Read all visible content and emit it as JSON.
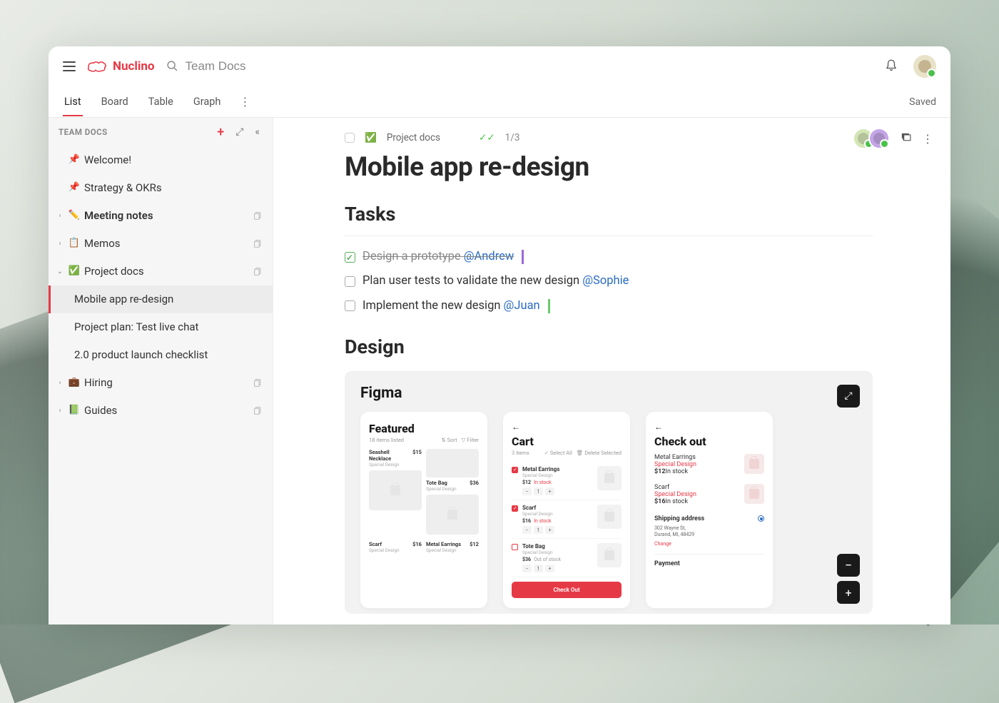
{
  "brand": "Nuclino",
  "search": {
    "placeholder": "Team Docs"
  },
  "saved_label": "Saved",
  "view_tabs": [
    "List",
    "Board",
    "Table",
    "Graph"
  ],
  "active_tab": 0,
  "sidebar": {
    "title": "TEAM DOCS",
    "items": [
      {
        "icon": "📌",
        "name": "Welcome!",
        "pinned": true
      },
      {
        "icon": "📌",
        "name": "Strategy & OKRs",
        "pinned": true
      },
      {
        "icon": "✏️",
        "name": "Meeting notes",
        "has_children": true,
        "bold": true,
        "copyable": true
      },
      {
        "icon": "📋",
        "name": "Memos",
        "has_children": true,
        "copyable": true
      },
      {
        "icon": "✅",
        "name": "Project docs",
        "has_children": true,
        "expanded": true,
        "copyable": true,
        "children": [
          {
            "name": "Mobile app re-design",
            "active": true
          },
          {
            "name": "Project plan: Test live chat"
          },
          {
            "name": "2.0 product launch checklist"
          }
        ]
      },
      {
        "icon": "💼",
        "name": "Hiring",
        "has_children": true,
        "copyable": true
      },
      {
        "icon": "📗",
        "name": "Guides",
        "has_children": true,
        "copyable": true
      }
    ]
  },
  "page": {
    "breadcrumb": {
      "icon": "✅",
      "label": "Project docs"
    },
    "progress": "1/3",
    "title": "Mobile app re-design",
    "sections": {
      "tasks_heading": "Tasks",
      "design_heading": "Design"
    },
    "tasks": [
      {
        "done": true,
        "text": "Design a prototype ",
        "mention": "@Andrew",
        "cursor": "purple"
      },
      {
        "done": false,
        "text": "Plan user tests to validate the new design ",
        "mention": "@Sophie"
      },
      {
        "done": false,
        "text": "Implement the new design ",
        "mention": "@Juan",
        "cursor": "green"
      }
    ]
  },
  "figma": {
    "title": "Figma",
    "screens": {
      "featured": {
        "heading": "Featured",
        "count_label": "18 items listed",
        "sort_label": "Sort",
        "filter_label": "Filter",
        "products": [
          {
            "name": "Seashell Necklace",
            "sub": "Special Design",
            "price": "$15"
          },
          {
            "name": "Tote Bag",
            "sub": "Special Design",
            "price": "$36"
          },
          {
            "name": "Scarf",
            "sub": "Special Design",
            "price": "$16"
          },
          {
            "name": "Metal Earrings",
            "sub": "Special Design",
            "price": "$12"
          }
        ]
      },
      "cart": {
        "heading": "Cart",
        "count_label": "3 items",
        "select_all": "Select All",
        "delete_selected": "Delete Selected",
        "items": [
          {
            "name": "Metal Earrings",
            "sub": "Special Design",
            "price": "$12",
            "stock": "In stock",
            "checked": true
          },
          {
            "name": "Scarf",
            "sub": "Special Design",
            "price": "$16",
            "stock": "In stock",
            "checked": true
          },
          {
            "name": "Tote Bag",
            "sub": "Special Design",
            "price": "$36",
            "stock": "Out of stock",
            "checked": false
          }
        ],
        "checkout_btn": "Check Out"
      },
      "checkout": {
        "heading": "Check out",
        "items": [
          {
            "name": "Metal Earrings",
            "sub": "Special Design",
            "price": "$12",
            "stock": "In stock"
          },
          {
            "name": "Scarf",
            "sub": "Special Design",
            "price": "$16",
            "stock": "In stock"
          }
        ],
        "shipping_heading": "Shipping address",
        "addr_line1": "302 Wayne St,",
        "addr_line2": "Durand, MI, 48429",
        "change_label": "Change",
        "payment_heading": "Payment"
      }
    }
  }
}
